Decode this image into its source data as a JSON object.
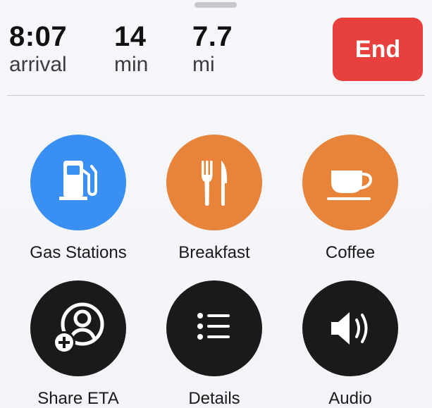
{
  "trip": {
    "arrival": {
      "value": "8:07",
      "unit": "arrival"
    },
    "duration": {
      "value": "14",
      "unit": "min"
    },
    "distance": {
      "value": "7.7",
      "unit": "mi"
    }
  },
  "end_button": {
    "label": "End"
  },
  "tiles": [
    {
      "label": "Gas Stations",
      "icon": "gas-pump-icon",
      "color": "#3a8ff3"
    },
    {
      "label": "Breakfast",
      "icon": "fork-knife-icon",
      "color": "#e8843a"
    },
    {
      "label": "Coffee",
      "icon": "coffee-cup-icon",
      "color": "#e8843a"
    },
    {
      "label": "Share ETA",
      "icon": "share-eta-person-icon",
      "color": "#1a1a1a"
    },
    {
      "label": "Details",
      "icon": "list-icon",
      "color": "#1a1a1a"
    },
    {
      "label": "Audio",
      "icon": "speaker-icon",
      "color": "#1a1a1a"
    }
  ],
  "colors": {
    "end_red": "#e8403d",
    "gas_blue": "#3a8ff3",
    "food_orange": "#e8843a",
    "dark": "#1a1a1a"
  }
}
